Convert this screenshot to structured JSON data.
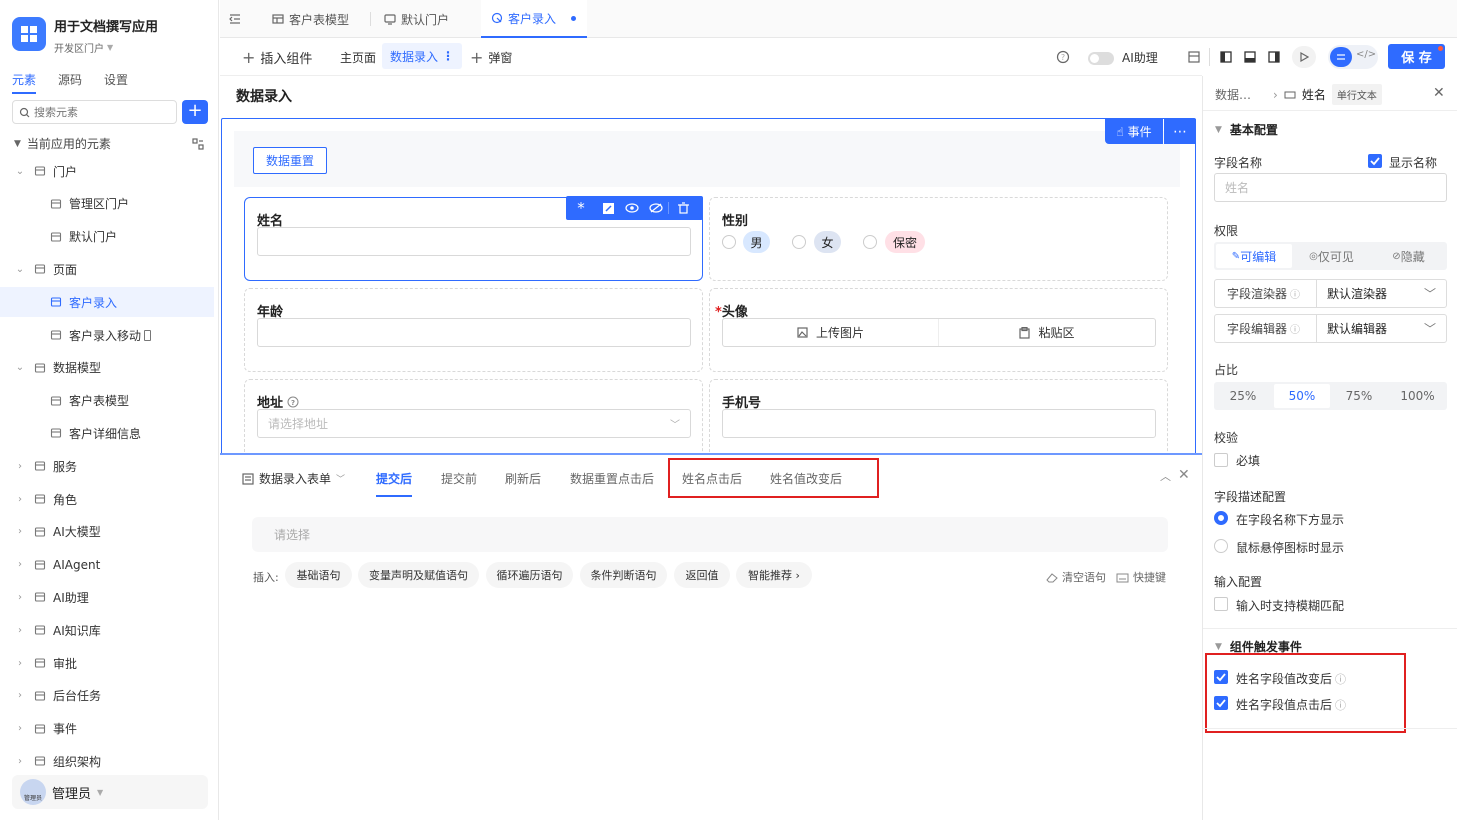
{
  "app": {
    "name": "用于文档撰写应用",
    "portal": "开发区门户"
  },
  "side_tabs": [
    "元素",
    "源码",
    "设置"
  ],
  "search": {
    "placeholder": "搜索元素"
  },
  "tree_header": "当前应用的元素",
  "tree": [
    {
      "label": "门户",
      "icon": "portal-icon",
      "toggle": "v"
    },
    {
      "label": "管理区门户",
      "icon": "portal-page-icon",
      "toggle": ""
    },
    {
      "label": "默认门户",
      "icon": "portal-page-icon",
      "toggle": ""
    },
    {
      "label": "页面",
      "icon": "pages-icon",
      "toggle": "v"
    },
    {
      "label": "客户录入",
      "icon": "form-page-icon",
      "toggle": ""
    },
    {
      "label": "客户录入移动",
      "icon": "form-page-icon",
      "toggle": ""
    },
    {
      "label": "数据模型",
      "icon": "table-icon",
      "toggle": "v"
    },
    {
      "label": "客户表模型",
      "icon": "table-icon",
      "toggle": ""
    },
    {
      "label": "客户详细信息",
      "icon": "table-icon",
      "toggle": ""
    },
    {
      "label": "服务",
      "icon": "service-icon",
      "toggle": ">"
    },
    {
      "label": "角色",
      "icon": "role-icon",
      "toggle": ">"
    },
    {
      "label": "AI大模型",
      "icon": "ai-model-icon",
      "toggle": ">"
    },
    {
      "label": "AIAgent",
      "icon": "agent-icon",
      "toggle": ">"
    },
    {
      "label": "AI助理",
      "icon": "ai-assistant-icon",
      "toggle": ">"
    },
    {
      "label": "AI知识库",
      "icon": "knowledge-icon",
      "toggle": ">"
    },
    {
      "label": "审批",
      "icon": "approval-icon",
      "toggle": ">"
    },
    {
      "label": "后台任务",
      "icon": "task-icon",
      "toggle": ">"
    },
    {
      "label": "事件",
      "icon": "event-icon",
      "toggle": ">"
    },
    {
      "label": "组织架构",
      "icon": "org-icon",
      "toggle": ">"
    }
  ],
  "user": {
    "name": "管理员",
    "avatar_text": "管理员"
  },
  "tabs": [
    {
      "label": "客户表模型"
    },
    {
      "label": "默认门户"
    },
    {
      "label": "客户录入"
    }
  ],
  "toolbar": {
    "insert": "插入组件",
    "main_page": "主页面",
    "data_entry": "数据录入",
    "popup": "弹窗",
    "ai_helper": "AI助理",
    "save": "保 存"
  },
  "page_title": "数据录入",
  "canvas": {
    "reset_button": "数据重置",
    "event_button": "事件",
    "fields": {
      "name": "姓名",
      "gender": "性别",
      "gender_options": [
        "男",
        "女",
        "保密"
      ],
      "age": "年龄",
      "avatar": "头像",
      "upload": "上传图片",
      "paste": "粘贴区",
      "address": "地址",
      "address_placeholder": "请选择地址",
      "phone": "手机号"
    }
  },
  "events_panel": {
    "form_name": "数据录入表单",
    "tabs": [
      "提交后",
      "提交前",
      "刷新后",
      "数据重置点击后",
      "姓名点击后",
      "姓名值改变后"
    ],
    "select_placeholder": "请选择",
    "insert_label": "插入:",
    "chips": [
      "基础语句",
      "变量声明及赋值语句",
      "循环遍历语句",
      "条件判断语句",
      "返回值",
      "智能推荐 ›"
    ],
    "clear": "清空语句",
    "shortcut": "快捷键"
  },
  "right": {
    "breadcrumb_parent": "数据…",
    "breadcrumb_current": "姓名",
    "type_tag": "单行文本",
    "basic": "基本配置",
    "field_name": "字段名称",
    "show_name": "显示名称",
    "field_placeholder": "姓名",
    "permission": "权限",
    "perm_options": [
      "可编辑",
      "仅可见",
      "隐藏"
    ],
    "renderer_label": "字段渲染器",
    "renderer_value": "默认渲染器",
    "editor_label": "字段编辑器",
    "editor_value": "默认编辑器",
    "ratio": "占比",
    "ratio_options": [
      "25%",
      "50%",
      "75%",
      "100%"
    ],
    "validation": "校验",
    "required": "必填",
    "desc_config": "字段描述配置",
    "desc_opt1": "在字段名称下方显示",
    "desc_opt2": "鼠标悬停图标时显示",
    "input_config": "输入配置",
    "fuzzy": "输入时支持模糊匹配",
    "events_title": "组件触发事件",
    "event1": "姓名字段值改变后",
    "event2": "姓名字段值点击后"
  },
  "colors": {
    "primary": "#2f6bff",
    "highlight_border": "#e02020"
  }
}
